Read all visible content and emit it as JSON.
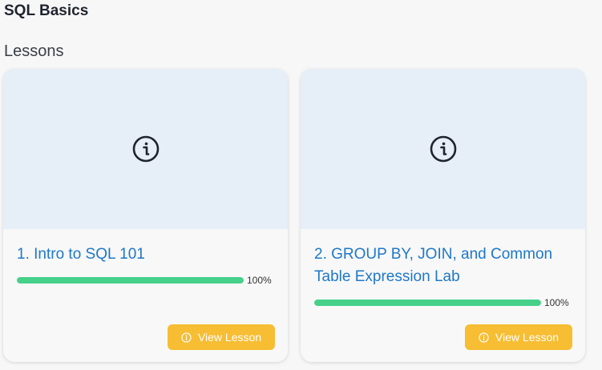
{
  "course": {
    "title": "SQL Basics"
  },
  "section": {
    "label": "Lessons"
  },
  "colors": {
    "accent": "#1e78c8",
    "progress": "#46d08a",
    "button": "#f7bd33",
    "thumb_bg": "#e6eef7"
  },
  "lessons": [
    {
      "title": "1. Intro to SQL 101",
      "progress_percent": 100,
      "progress_label": "100%",
      "button_label": "View Lesson",
      "thumb_icon": "info-icon",
      "button_icon": "info-icon"
    },
    {
      "title": "2. GROUP BY, JOIN, and Common Table Expression Lab",
      "progress_percent": 100,
      "progress_label": "100%",
      "button_label": "View Lesson",
      "thumb_icon": "info-icon",
      "button_icon": "info-icon"
    }
  ]
}
